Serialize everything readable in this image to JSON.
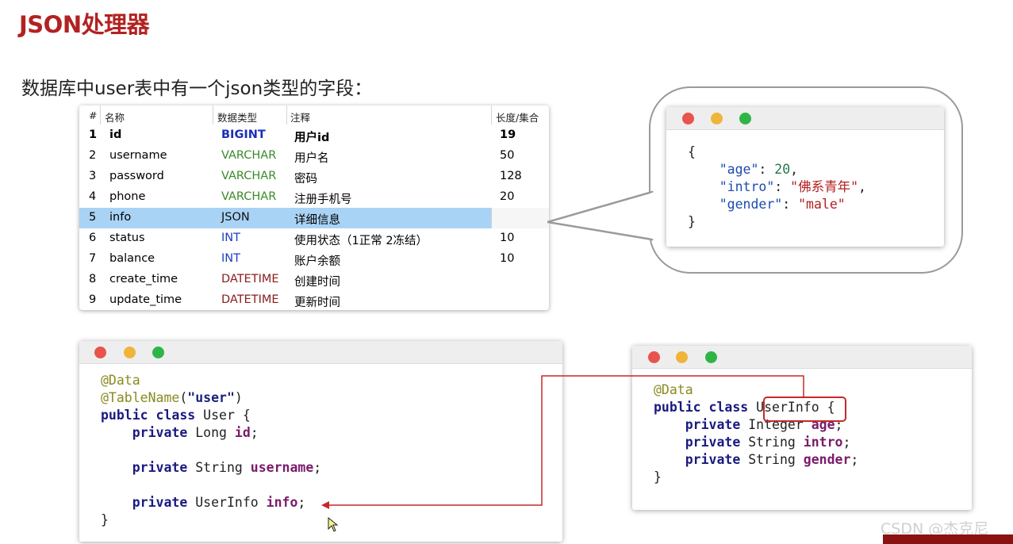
{
  "title": "JSON处理器",
  "subtitle": "数据库中user表中有一个json类型的字段：",
  "table": {
    "headers": {
      "num": "#",
      "name": "名称",
      "type": "数据类型",
      "comment": "注释",
      "length": "长度/集合"
    },
    "rows": [
      {
        "num": "1",
        "name": "id",
        "type": "BIGINT",
        "comment": "用户id",
        "length": "19"
      },
      {
        "num": "2",
        "name": "username",
        "type": "VARCHAR",
        "comment": "用户名",
        "length": "50"
      },
      {
        "num": "3",
        "name": "password",
        "type": "VARCHAR",
        "comment": "密码",
        "length": "128"
      },
      {
        "num": "4",
        "name": "phone",
        "type": "VARCHAR",
        "comment": "注册手机号",
        "length": "20"
      },
      {
        "num": "5",
        "name": "info",
        "type": "JSON",
        "comment": "详细信息",
        "length": ""
      },
      {
        "num": "6",
        "name": "status",
        "type": "INT",
        "comment": "使用状态（1正常 2冻结）",
        "length": "10"
      },
      {
        "num": "7",
        "name": "balance",
        "type": "INT",
        "comment": "账户余额",
        "length": "10"
      },
      {
        "num": "8",
        "name": "create_time",
        "type": "DATETIME",
        "comment": "创建时间",
        "length": ""
      },
      {
        "num": "9",
        "name": "update_time",
        "type": "DATETIME",
        "comment": "更新时间",
        "length": ""
      }
    ],
    "selected_row": 5
  },
  "json_window": {
    "open": "{",
    "age_key": "\"age\"",
    "colon1": ": ",
    "age_val": "20",
    "comma1": ",",
    "intro_key": "\"intro\"",
    "colon2": ": ",
    "intro_val": "\"佛系青年\"",
    "comma2": ",",
    "gender_key": "\"gender\"",
    "colon3": ": ",
    "gender_val": "\"male\"",
    "close": "}"
  },
  "user_code": {
    "ann_data": "@Data",
    "ann_table": "@TableName",
    "paren_open": "(",
    "table_arg": "\"user\"",
    "paren_close": ")",
    "kw_public_class": "public class",
    "class_name": " User {",
    "kw_private1": "private",
    "type1": " Long ",
    "field1": "id",
    "semi1": ";",
    "kw_private2": "private",
    "type2": " String ",
    "field2": "username",
    "semi2": ";",
    "kw_private3": "private",
    "type3": " UserInfo ",
    "field3": "info",
    "semi3": ";",
    "close": "}"
  },
  "userinfo_code": {
    "ann_data": "@Data",
    "kw_public_class": "public class",
    "class_name": "UserInfo",
    "open_brace": "{",
    "kw_private1": "private",
    "type1": " Integer ",
    "field1": "age",
    "semi1": ";",
    "kw_private2": "private",
    "type2": " String ",
    "field2": "intro",
    "semi2": ";",
    "kw_private3": "private",
    "type3": " String ",
    "field3": "gender",
    "semi3": ";",
    "close": "}"
  },
  "watermark": "CSDN @杰克尼",
  "colors": {
    "title": "#b22222",
    "selected_row": "#a9d3f5",
    "arrow": "#c62828",
    "dot_red": "#e9534c",
    "dot_yellow": "#f0b43a",
    "dot_green": "#2fb547"
  }
}
